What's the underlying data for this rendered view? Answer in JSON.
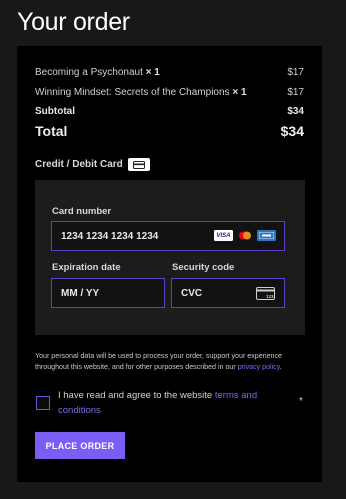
{
  "page": {
    "title": "Your order"
  },
  "order": {
    "items": [
      {
        "name": "Becoming a Psychonaut",
        "qty": "× 1",
        "price": "$17"
      },
      {
        "name": "Winning Mindset: Secrets of the Champions",
        "qty": "× 1",
        "price": "$17"
      }
    ],
    "subtotal_label": "Subtotal",
    "subtotal_value": "$34",
    "total_label": "Total",
    "total_value": "$34"
  },
  "payment": {
    "section_label": "Credit / Debit Card",
    "card_number_label": "Card number",
    "card_number_placeholder": "1234 1234 1234 1234",
    "expiration_label": "Expiration date",
    "expiration_placeholder": "MM / YY",
    "security_label": "Security code",
    "security_placeholder": "CVC",
    "brands": [
      "VISA",
      "mastercard",
      "amex"
    ],
    "cvc_hint": "123"
  },
  "privacy": {
    "text": "Your personal data will be used to process your order, support your experience throughout this website, and for other purposes described in our ",
    "link": "privacy policy",
    "end": "."
  },
  "terms": {
    "text": "I have read and agree to the website ",
    "link": "terms and conditions",
    "required": "*"
  },
  "actions": {
    "place_order": "PLACE ORDER"
  },
  "colors": {
    "accent": "#7b5cf5",
    "panel": "#000000",
    "background": "#181818",
    "link": "#7e6bea"
  }
}
